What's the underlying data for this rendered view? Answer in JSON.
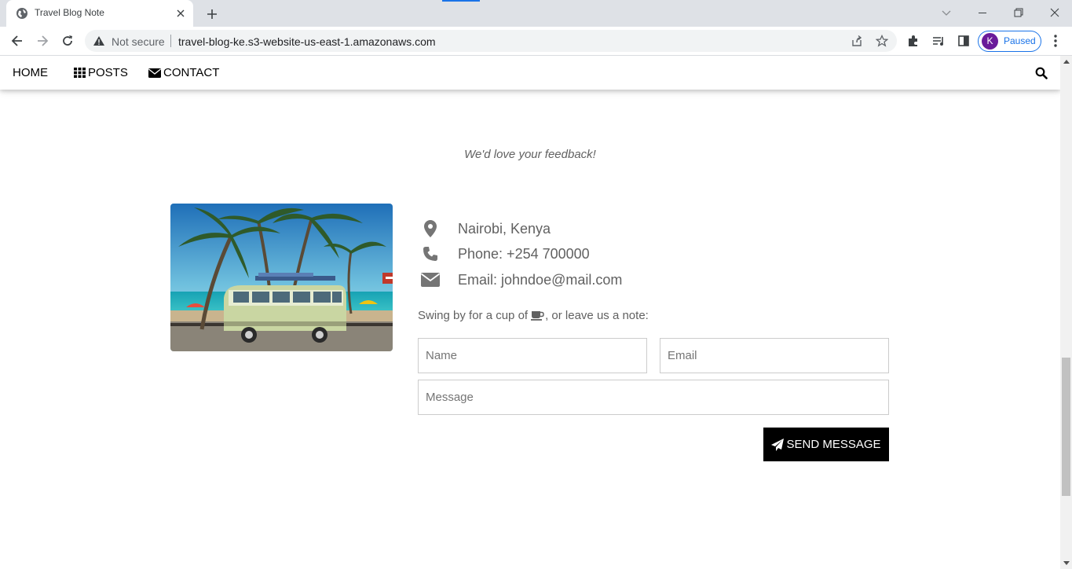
{
  "browser": {
    "tab_title": "Travel Blog Note",
    "security_label": "Not secure",
    "url": "travel-blog-ke.s3-website-us-east-1.amazonaws.com",
    "profile_initial": "K",
    "profile_status": "Paused",
    "accent_color": "#1a73e8",
    "avatar_color": "#6a1b9a"
  },
  "nav": {
    "home_label": "HOME",
    "posts_label": "POSTS",
    "contact_label": "CONTACT",
    "icons": [
      "th-grid-icon",
      "envelope-icon",
      "search-icon"
    ]
  },
  "contact": {
    "tagline": "We'd love your feedback!",
    "location": "Nairobi, Kenya",
    "phone": "Phone: +254 700000",
    "email": "Email: johndoe@mail.com",
    "note_before": "Swing by for a cup of",
    "note_after": ", or leave us a note:",
    "name_placeholder": "Name",
    "email_placeholder": "Email",
    "message_placeholder": "Message",
    "send_label": "SEND MESSAGE",
    "icons": [
      "map-marker-icon",
      "phone-icon",
      "envelope-icon",
      "coffee-icon",
      "paper-plane-icon"
    ]
  }
}
